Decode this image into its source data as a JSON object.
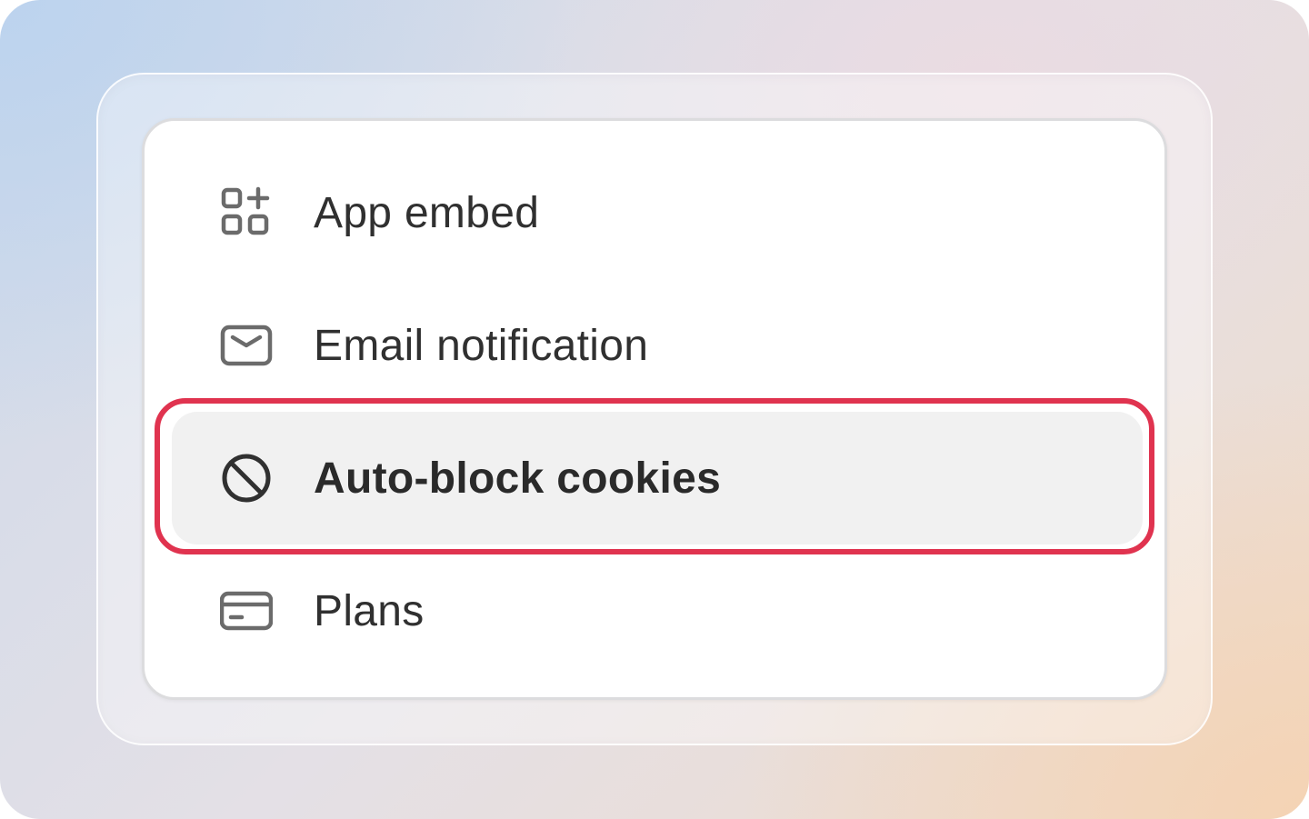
{
  "menu": {
    "items": [
      {
        "label": "App embed",
        "icon": "app-embed-icon"
      },
      {
        "label": "Email notification",
        "icon": "email-icon"
      },
      {
        "label": "Auto-block cookies",
        "icon": "block-icon",
        "selected": true
      },
      {
        "label": "Plans",
        "icon": "credit-card-icon"
      }
    ]
  },
  "colors": {
    "highlight": "#e0334f",
    "selected_background": "#f1f1f1",
    "text": "#303030",
    "icon": "#6b6b6b"
  }
}
